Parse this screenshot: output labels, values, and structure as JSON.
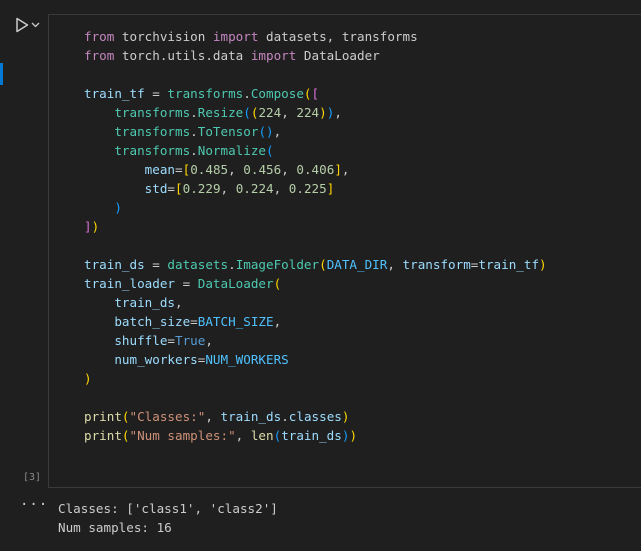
{
  "cell": {
    "execution_count": "[3]",
    "code_lines": [
      [
        {
          "t": "from",
          "c": "kw"
        },
        {
          "t": " torchvision ",
          "c": "plain"
        },
        {
          "t": "import",
          "c": "kw"
        },
        {
          "t": " datasets, transforms",
          "c": "plain"
        }
      ],
      [
        {
          "t": "from",
          "c": "kw"
        },
        {
          "t": " torch.utils.data ",
          "c": "plain"
        },
        {
          "t": "import",
          "c": "kw"
        },
        {
          "t": " DataLoader",
          "c": "plain"
        }
      ],
      [],
      [
        {
          "t": "train_tf",
          "c": "var"
        },
        {
          "t": " = ",
          "c": "plain"
        },
        {
          "t": "transforms",
          "c": "cls"
        },
        {
          "t": ".",
          "c": "plain"
        },
        {
          "t": "Compose",
          "c": "cls"
        },
        {
          "t": "(",
          "c": "br1"
        },
        {
          "t": "[",
          "c": "br2"
        }
      ],
      [
        {
          "t": "    ",
          "c": "plain"
        },
        {
          "t": "transforms",
          "c": "cls"
        },
        {
          "t": ".",
          "c": "plain"
        },
        {
          "t": "Resize",
          "c": "cls"
        },
        {
          "t": "(",
          "c": "br3"
        },
        {
          "t": "(",
          "c": "br1"
        },
        {
          "t": "224",
          "c": "num"
        },
        {
          "t": ", ",
          "c": "plain"
        },
        {
          "t": "224",
          "c": "num"
        },
        {
          "t": ")",
          "c": "br1"
        },
        {
          "t": ")",
          "c": "br3"
        },
        {
          "t": ",",
          "c": "plain"
        }
      ],
      [
        {
          "t": "    ",
          "c": "plain"
        },
        {
          "t": "transforms",
          "c": "cls"
        },
        {
          "t": ".",
          "c": "plain"
        },
        {
          "t": "ToTensor",
          "c": "cls"
        },
        {
          "t": "(",
          "c": "br3"
        },
        {
          "t": ")",
          "c": "br3"
        },
        {
          "t": ",",
          "c": "plain"
        }
      ],
      [
        {
          "t": "    ",
          "c": "plain"
        },
        {
          "t": "transforms",
          "c": "cls"
        },
        {
          "t": ".",
          "c": "plain"
        },
        {
          "t": "Normalize",
          "c": "cls"
        },
        {
          "t": "(",
          "c": "br3"
        }
      ],
      [
        {
          "t": "        ",
          "c": "plain"
        },
        {
          "t": "mean",
          "c": "var"
        },
        {
          "t": "=",
          "c": "plain"
        },
        {
          "t": "[",
          "c": "br1"
        },
        {
          "t": "0.485",
          "c": "num"
        },
        {
          "t": ", ",
          "c": "plain"
        },
        {
          "t": "0.456",
          "c": "num"
        },
        {
          "t": ", ",
          "c": "plain"
        },
        {
          "t": "0.406",
          "c": "num"
        },
        {
          "t": "]",
          "c": "br1"
        },
        {
          "t": ",",
          "c": "plain"
        }
      ],
      [
        {
          "t": "        ",
          "c": "plain"
        },
        {
          "t": "std",
          "c": "var"
        },
        {
          "t": "=",
          "c": "plain"
        },
        {
          "t": "[",
          "c": "br1"
        },
        {
          "t": "0.229",
          "c": "num"
        },
        {
          "t": ", ",
          "c": "plain"
        },
        {
          "t": "0.224",
          "c": "num"
        },
        {
          "t": ", ",
          "c": "plain"
        },
        {
          "t": "0.225",
          "c": "num"
        },
        {
          "t": "]",
          "c": "br1"
        }
      ],
      [
        {
          "t": "    ",
          "c": "plain"
        },
        {
          "t": ")",
          "c": "br3"
        }
      ],
      [
        {
          "t": "]",
          "c": "br2"
        },
        {
          "t": ")",
          "c": "br1"
        }
      ],
      [],
      [
        {
          "t": "train_ds",
          "c": "var"
        },
        {
          "t": " = ",
          "c": "plain"
        },
        {
          "t": "datasets",
          "c": "cls"
        },
        {
          "t": ".",
          "c": "plain"
        },
        {
          "t": "ImageFolder",
          "c": "cls"
        },
        {
          "t": "(",
          "c": "br1"
        },
        {
          "t": "DATA_DIR",
          "c": "const"
        },
        {
          "t": ", ",
          "c": "plain"
        },
        {
          "t": "transform",
          "c": "var"
        },
        {
          "t": "=",
          "c": "plain"
        },
        {
          "t": "train_tf",
          "c": "var"
        },
        {
          "t": ")",
          "c": "br1"
        }
      ],
      [
        {
          "t": "train_loader",
          "c": "var"
        },
        {
          "t": " = ",
          "c": "plain"
        },
        {
          "t": "DataLoader",
          "c": "cls"
        },
        {
          "t": "(",
          "c": "br1"
        }
      ],
      [
        {
          "t": "    ",
          "c": "plain"
        },
        {
          "t": "train_ds",
          "c": "var"
        },
        {
          "t": ",",
          "c": "plain"
        }
      ],
      [
        {
          "t": "    ",
          "c": "plain"
        },
        {
          "t": "batch_size",
          "c": "var"
        },
        {
          "t": "=",
          "c": "plain"
        },
        {
          "t": "BATCH_SIZE",
          "c": "const"
        },
        {
          "t": ",",
          "c": "plain"
        }
      ],
      [
        {
          "t": "    ",
          "c": "plain"
        },
        {
          "t": "shuffle",
          "c": "var"
        },
        {
          "t": "=",
          "c": "plain"
        },
        {
          "t": "True",
          "c": "lit"
        },
        {
          "t": ",",
          "c": "plain"
        }
      ],
      [
        {
          "t": "    ",
          "c": "plain"
        },
        {
          "t": "num_workers",
          "c": "var"
        },
        {
          "t": "=",
          "c": "plain"
        },
        {
          "t": "NUM_WORKERS",
          "c": "const"
        }
      ],
      [
        {
          "t": ")",
          "c": "br1"
        }
      ],
      [],
      [
        {
          "t": "print",
          "c": "fn"
        },
        {
          "t": "(",
          "c": "br1"
        },
        {
          "t": "\"Classes:\"",
          "c": "str"
        },
        {
          "t": ", ",
          "c": "plain"
        },
        {
          "t": "train_ds",
          "c": "var"
        },
        {
          "t": ".",
          "c": "plain"
        },
        {
          "t": "classes",
          "c": "var"
        },
        {
          "t": ")",
          "c": "br1"
        }
      ],
      [
        {
          "t": "print",
          "c": "fn"
        },
        {
          "t": "(",
          "c": "br1"
        },
        {
          "t": "\"Num samples:\"",
          "c": "str"
        },
        {
          "t": ", ",
          "c": "plain"
        },
        {
          "t": "len",
          "c": "fn"
        },
        {
          "t": "(",
          "c": "br3"
        },
        {
          "t": "train_ds",
          "c": "var"
        },
        {
          "t": ")",
          "c": "br3"
        },
        {
          "t": ")",
          "c": "br1"
        }
      ]
    ]
  },
  "output": {
    "more_label": "···",
    "lines": [
      "Classes: ['class1', 'class2']",
      "Num samples: 16"
    ]
  },
  "colors": {
    "background": "#1f1f1f",
    "cell_border": "#3a3a3a",
    "focus_accent": "#0078d4",
    "run_icon": "#cccccc"
  },
  "icons": {
    "run": "run-cell-icon",
    "run_menu": "chevron-down-icon"
  }
}
